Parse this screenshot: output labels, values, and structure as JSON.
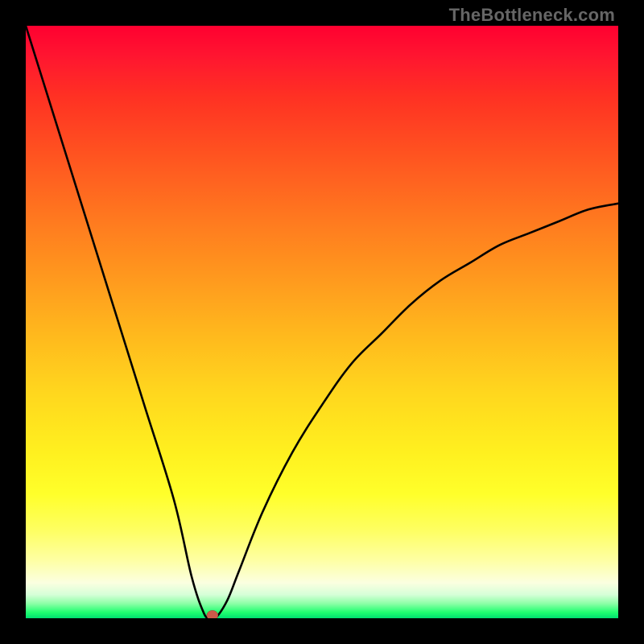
{
  "attribution": "TheBottleneck.com",
  "chart_data": {
    "type": "line",
    "title": "",
    "xlabel": "",
    "ylabel": "",
    "xlim": [
      0,
      100
    ],
    "ylim": [
      0,
      100
    ],
    "grid": false,
    "legend": false,
    "series": [
      {
        "name": "curve",
        "x": [
          0,
          5,
          10,
          15,
          20,
          25,
          28,
          30,
          31,
          32,
          34,
          36,
          40,
          45,
          50,
          55,
          60,
          65,
          70,
          75,
          80,
          85,
          90,
          95,
          100
        ],
        "values": [
          100,
          84,
          68,
          52,
          36,
          20,
          7,
          1,
          0,
          0,
          3,
          8,
          18,
          28,
          36,
          43,
          48,
          53,
          57,
          60,
          63,
          65,
          67,
          69,
          70
        ]
      }
    ],
    "marker": {
      "x": 31.5,
      "y": 0.5,
      "color": "#cc5a4a"
    },
    "background_gradient": {
      "top_color": "#ff0030",
      "bottom_color": "#00e070",
      "stops": [
        "red",
        "orange",
        "yellow",
        "pale-yellow",
        "green"
      ]
    }
  }
}
